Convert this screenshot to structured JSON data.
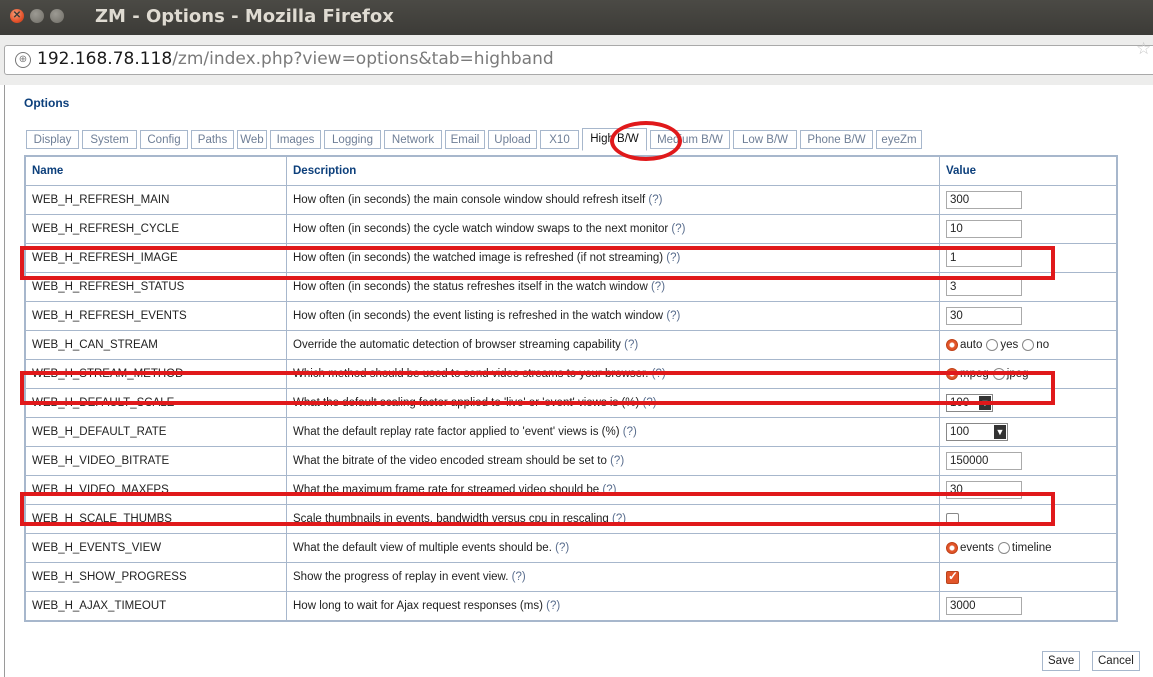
{
  "window": {
    "title": "ZM - Options - Mozilla Firefox"
  },
  "urlbar": {
    "host": "192.168.78.118",
    "path": "/zm/index.php?view=options&tab=highband"
  },
  "page": {
    "title": "Options"
  },
  "tabs": [
    "Display",
    "System",
    "Config",
    "Paths",
    "Web",
    "Images",
    "Logging",
    "Network",
    "Email",
    "Upload",
    "X10",
    "High B/W",
    "Medium B/W",
    "Low B/W",
    "Phone B/W",
    "eyeZm"
  ],
  "active_tab": "High B/W",
  "table": {
    "headers": {
      "name": "Name",
      "description": "Description",
      "value": "Value"
    },
    "help_marker": "(?)",
    "rows": [
      {
        "name": "WEB_H_REFRESH_MAIN",
        "description": "How often (in seconds) the main console window should refresh itself",
        "value": "300"
      },
      {
        "name": "WEB_H_REFRESH_CYCLE",
        "description": "How often (in seconds) the cycle watch window swaps to the next monitor",
        "value": "10"
      },
      {
        "name": "WEB_H_REFRESH_IMAGE",
        "description": "How often (in seconds) the watched image is refreshed (if not streaming)",
        "value": "1"
      },
      {
        "name": "WEB_H_REFRESH_STATUS",
        "description": "How often (in seconds) the status refreshes itself in the watch window",
        "value": "3"
      },
      {
        "name": "WEB_H_REFRESH_EVENTS",
        "description": "How often (in seconds) the event listing is refreshed in the watch window",
        "value": "30"
      },
      {
        "name": "WEB_H_CAN_STREAM",
        "description": "Override the automatic detection of browser streaming capability",
        "options": [
          "auto",
          "yes",
          "no"
        ],
        "selected": "auto"
      },
      {
        "name": "WEB_H_STREAM_METHOD",
        "description": "Which method should be used to send video streams to your browser.",
        "options": [
          "mpeg",
          "jpeg"
        ],
        "selected": "mpeg"
      },
      {
        "name": "WEB_H_DEFAULT_SCALE",
        "description": "What the default scaling factor applied to 'live' or 'event' views is (%)",
        "value": "100"
      },
      {
        "name": "WEB_H_DEFAULT_RATE",
        "description": "What the default replay rate factor applied to 'event' views is (%)",
        "value": "100"
      },
      {
        "name": "WEB_H_VIDEO_BITRATE",
        "description": "What the bitrate of the video encoded stream should be set to",
        "value": "150000"
      },
      {
        "name": "WEB_H_VIDEO_MAXFPS",
        "description": "What the maximum frame rate for streamed video should be",
        "value": "30"
      },
      {
        "name": "WEB_H_SCALE_THUMBS",
        "description": "Scale thumbnails in events, bandwidth versus cpu in rescaling",
        "checked": false
      },
      {
        "name": "WEB_H_EVENTS_VIEW",
        "description": "What the default view of multiple events should be.",
        "options": [
          "events",
          "timeline"
        ],
        "selected": "events"
      },
      {
        "name": "WEB_H_SHOW_PROGRESS",
        "description": "Show the progress of replay in event view.",
        "checked": true
      },
      {
        "name": "WEB_H_AJAX_TIMEOUT",
        "description": "How long to wait for Ajax request responses (ms)",
        "value": "3000"
      }
    ]
  },
  "buttons": {
    "save": "Save",
    "cancel": "Cancel"
  },
  "colors": {
    "accent": "#0c3f7b",
    "highlight": "#e0191b",
    "radio_on": "#e2552a"
  }
}
